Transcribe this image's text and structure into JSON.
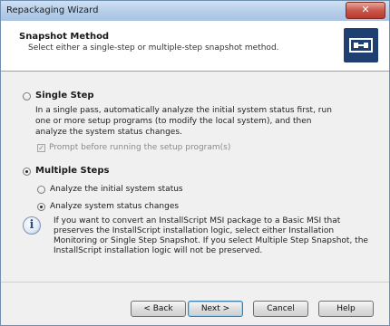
{
  "window": {
    "title": "Repackaging Wizard",
    "close_label": "✕"
  },
  "header": {
    "title": "Snapshot Method",
    "subtitle": "Select either a single-step or multiple-step snapshot method."
  },
  "options": {
    "single_step": {
      "label": "Single Step",
      "selected": false,
      "description": "In a single pass, automatically analyze the initial system status first, run one or more setup programs (to modify the local system), and then analyze the system status changes.",
      "prompt_checkbox_label": "Prompt before running the setup program(s)",
      "prompt_checked": true,
      "prompt_enabled": false
    },
    "multiple_steps": {
      "label": "Multiple Steps",
      "selected": true,
      "sub_options": [
        {
          "label": "Analyze the initial system status",
          "selected": false
        },
        {
          "label": "Analyze system status changes",
          "selected": true
        }
      ]
    }
  },
  "info_note": "If you want to convert an InstallScript MSI package to a Basic MSI that preserves the InstallScript installation logic, select either Installation Monitoring or Single Step Snapshot. If you select Multiple Step Snapshot, the InstallScript installation logic will not be preserved.",
  "buttons": {
    "back": "< Back",
    "next": "Next >",
    "cancel": "Cancel",
    "help": "Help"
  },
  "colors": {
    "header_icon_bg": "#1f3f72",
    "close_button": "#c9574a",
    "default_button_border": "#3c7fb1"
  },
  "icons": {
    "header": "snapshot-icon",
    "info": "info-icon"
  }
}
